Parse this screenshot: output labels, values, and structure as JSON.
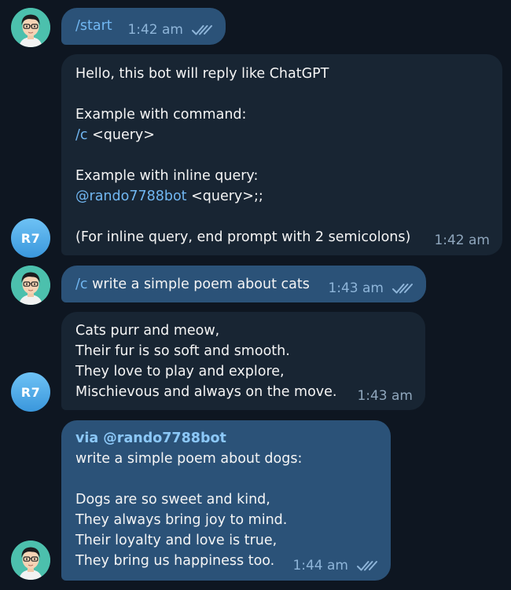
{
  "colors": {
    "background": "#0e1621",
    "outgoing_bubble": "#2b5278",
    "incoming_bubble": "#182533",
    "link": "#71b7f2",
    "bot_avatar": "#3a97dc"
  },
  "bot": {
    "avatar_initials": "R7"
  },
  "messages": [
    {
      "direction": "outgoing",
      "command": "/start",
      "time": "1:42 am",
      "status_icon": "double-check-icon"
    },
    {
      "direction": "incoming",
      "lines": [
        "Hello, this bot will reply like ChatGPT",
        "",
        "Example with command:",
        "",
        "",
        "Example with inline query:",
        "",
        "",
        "(For inline query, end prompt with 2 semicolons)"
      ],
      "command_example": {
        "command": "/c",
        "rest": " <query>"
      },
      "inline_example": {
        "mention": "@rando7788bot",
        "rest": " <query>;;"
      },
      "time": "1:42 am"
    },
    {
      "direction": "outgoing",
      "command": "/c",
      "text": " write a simple poem about cats",
      "time": "1:43 am",
      "status_icon": "double-check-icon"
    },
    {
      "direction": "incoming",
      "lines": [
        "Cats purr and meow,",
        "Their fur is so soft and smooth.",
        "They love to play and explore,",
        "Mischievous and always on the move."
      ],
      "time": "1:43 am"
    },
    {
      "direction": "outgoing",
      "via": "via @rando7788bot",
      "lines": [
        "write a simple poem about dogs:",
        "",
        "Dogs are so sweet and kind,",
        "They always bring joy to mind.",
        "Their loyalty and love is true,",
        "They bring us happiness too."
      ],
      "time": "1:44 am",
      "status_icon": "double-check-icon"
    }
  ]
}
